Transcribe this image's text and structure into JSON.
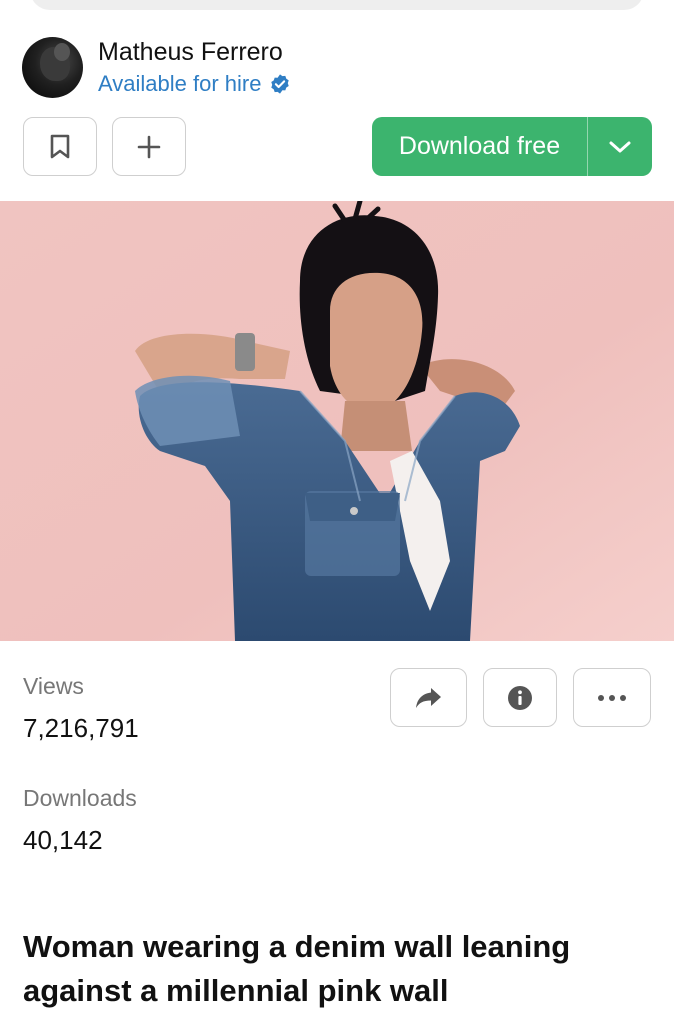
{
  "author": {
    "name": "Matheus Ferrero",
    "status": "Available for hire"
  },
  "actions": {
    "download_label": "Download free"
  },
  "stats": {
    "views_label": "Views",
    "views_value": "7,216,791",
    "downloads_label": "Downloads",
    "downloads_value": "40,142"
  },
  "photo": {
    "title": "Woman wearing a denim wall leaning against a millennial pink wall"
  },
  "colors": {
    "accent_green": "#3cb46e",
    "link_blue": "#2f7ec4",
    "background_pink": "#f2c7c4"
  },
  "icons": [
    "search-bar",
    "verified-check-icon",
    "bookmark-icon",
    "plus-icon",
    "chevron-down-icon",
    "share-arrow-icon",
    "info-icon",
    "more-dots-icon"
  ]
}
